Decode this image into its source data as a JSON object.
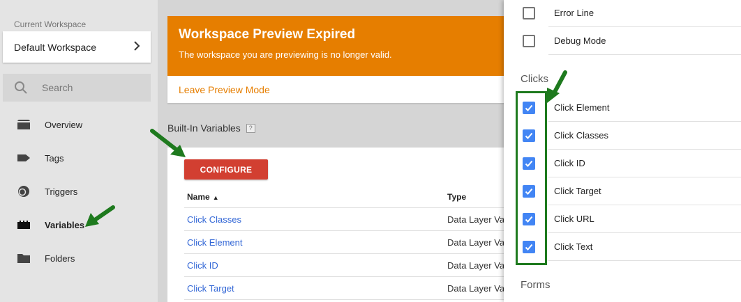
{
  "sidebar": {
    "workspace_label": "Current Workspace",
    "workspace_name": "Default Workspace",
    "search_placeholder": "Search",
    "items": [
      {
        "label": "Overview",
        "icon": "overview-icon"
      },
      {
        "label": "Tags",
        "icon": "tag-icon"
      },
      {
        "label": "Triggers",
        "icon": "trigger-icon"
      },
      {
        "label": "Variables",
        "icon": "variables-icon"
      },
      {
        "label": "Folders",
        "icon": "folder-icon"
      }
    ]
  },
  "banner": {
    "title": "Workspace Preview Expired",
    "message": "The workspace you are previewing is no longer valid.",
    "action": "Leave Preview Mode"
  },
  "builtin": {
    "title": "Built-In Variables",
    "help": "?",
    "configure_label": "CONFIGURE",
    "columns": {
      "name": "Name",
      "type": "Type"
    },
    "rows": [
      {
        "name": "Click Classes",
        "type": "Data Layer Va"
      },
      {
        "name": "Click Element",
        "type": "Data Layer Va"
      },
      {
        "name": "Click ID",
        "type": "Data Layer Va"
      },
      {
        "name": "Click Target",
        "type": "Data Layer Va"
      }
    ]
  },
  "panel": {
    "top_items": [
      {
        "label": "Error Line",
        "checked": false
      },
      {
        "label": "Debug Mode",
        "checked": false
      }
    ],
    "clicks_heading": "Clicks",
    "click_items": [
      {
        "label": "Click Element",
        "checked": true
      },
      {
        "label": "Click Classes",
        "checked": true
      },
      {
        "label": "Click ID",
        "checked": true
      },
      {
        "label": "Click Target",
        "checked": true
      },
      {
        "label": "Click URL",
        "checked": true
      },
      {
        "label": "Click Text",
        "checked": true
      }
    ],
    "forms_heading": "Forms"
  },
  "colors": {
    "banner": "#e67e00",
    "configure": "#d23f31",
    "checkbox": "#4285f4",
    "link": "#3367d6",
    "annotation": "#1e7a1e"
  }
}
